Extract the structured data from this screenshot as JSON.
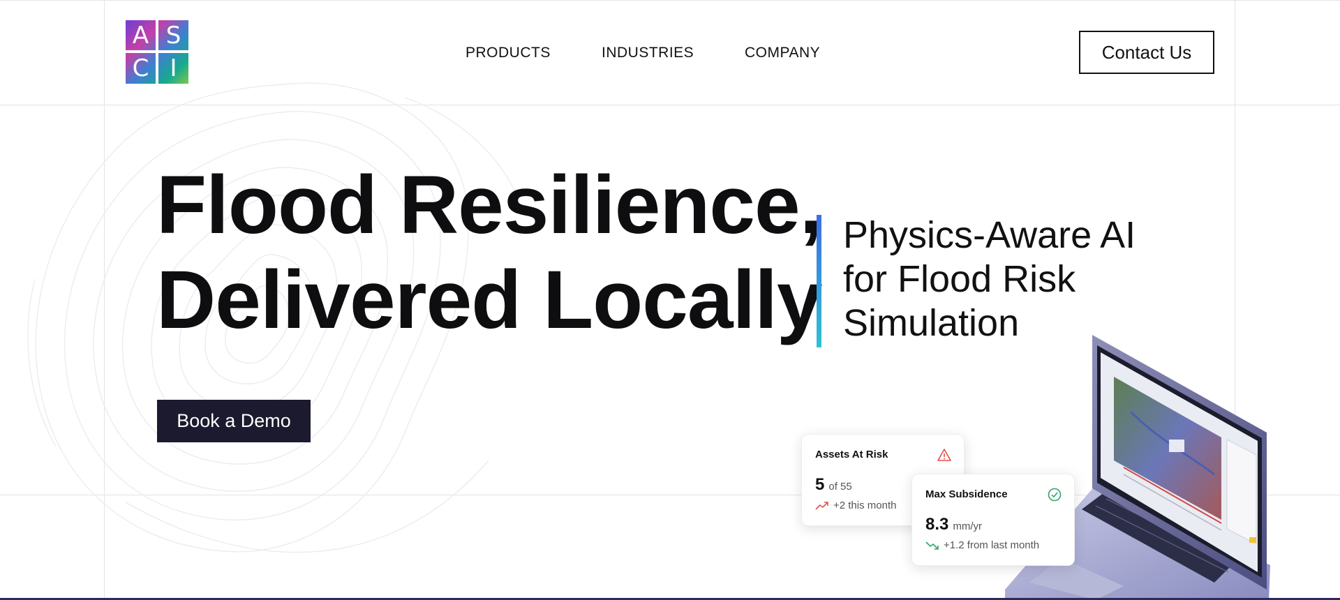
{
  "logo": {
    "letters": [
      "A",
      "S",
      "C",
      "I"
    ]
  },
  "nav": {
    "items": [
      "PRODUCTS",
      "INDUSTRIES",
      "COMPANY"
    ]
  },
  "header": {
    "contact_label": "Contact Us"
  },
  "hero": {
    "title_line1": "Flood Resilience,",
    "title_line2": "Delivered Locally",
    "tagline_line1": "Physics-Aware AI",
    "tagline_line2": "for Flood Risk",
    "tagline_line3": "Simulation",
    "cta_label": "Book a Demo"
  },
  "cards": {
    "assets": {
      "title": "Assets At Risk",
      "value": "5",
      "unit": "of 55",
      "trend": "+2 this month",
      "icon": "warning-triangle-icon",
      "trend_icon": "trend-up-icon",
      "accent": "#e0504a"
    },
    "subsidence": {
      "title": "Max Subsidence",
      "value": "8.3",
      "unit": "mm/yr",
      "trend": "+1.2 from last month",
      "icon": "check-circle-icon",
      "trend_icon": "trend-down-icon",
      "accent": "#2fa36b"
    }
  },
  "colors": {
    "cta_bg": "#1b1a2e",
    "accent_gradient_top": "#3d6ee3",
    "accent_gradient_bottom": "#2fc0d3"
  }
}
